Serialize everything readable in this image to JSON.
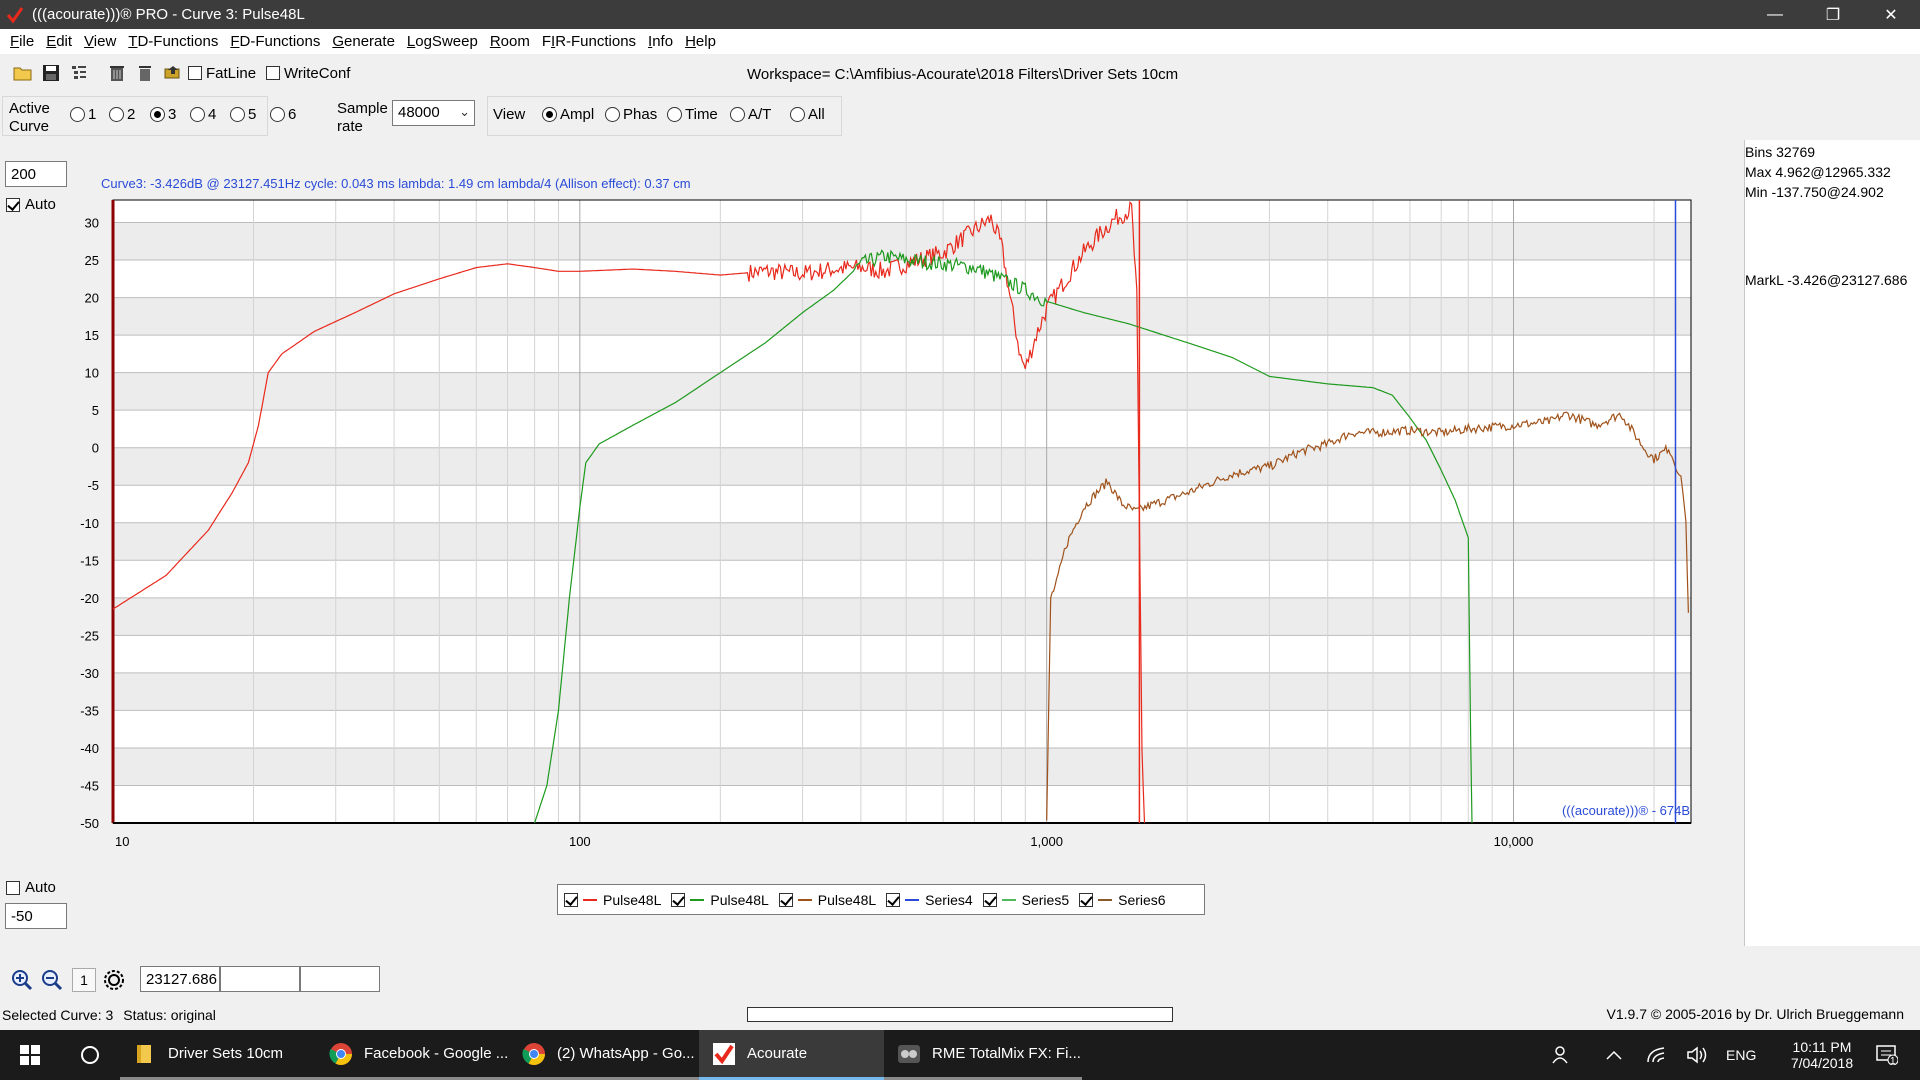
{
  "window": {
    "title": "(((acourate)))® PRO - Curve 3: Pulse48L",
    "controls": [
      "minimize",
      "restore",
      "close"
    ]
  },
  "menu": [
    {
      "pre": "",
      "ul": "F",
      "post": "ile"
    },
    {
      "pre": "",
      "ul": "E",
      "post": "dit"
    },
    {
      "pre": "",
      "ul": "V",
      "post": "iew"
    },
    {
      "pre": "",
      "ul": "T",
      "post": "D-Functions"
    },
    {
      "pre": "",
      "ul": "F",
      "post": "D-Functions"
    },
    {
      "pre": "",
      "ul": "G",
      "post": "enerate"
    },
    {
      "pre": "",
      "ul": "L",
      "post": "ogSweep"
    },
    {
      "pre": "",
      "ul": "R",
      "post": "oom"
    },
    {
      "pre": "F",
      "ul": "I",
      "post": "R-Functions"
    },
    {
      "pre": "",
      "ul": "I",
      "post": "nfo"
    },
    {
      "pre": "",
      "ul": "H",
      "post": "elp"
    }
  ],
  "toolbar": {
    "icons": [
      "open-folder-icon",
      "save-disk-icon",
      "tree-list-icon",
      "delete-stack-icon",
      "trash-icon",
      "import-icon"
    ],
    "fatline_label": "FatLine",
    "fatline_checked": false,
    "writeconf_label": "WriteConf",
    "writeconf_checked": false,
    "workspace": "Workspace= C:\\Amfibius-Acourate\\2018 Filters\\Driver Sets 10cm"
  },
  "curve_row": {
    "active_curve_label_1": "Active",
    "active_curve_label_2": "Curve",
    "curves": [
      "1",
      "2",
      "3",
      "4",
      "5",
      "6"
    ],
    "selected_curve": "3",
    "sample_rate_label_1": "Sample",
    "sample_rate_label_2": "rate",
    "sample_rate_value": "48000",
    "view_label": "View",
    "view_options": [
      "Ampl",
      "Phas",
      "Time",
      "A/T",
      "All"
    ],
    "selected_view": "Ampl"
  },
  "plot_controls": {
    "ymax_value": "200",
    "top_auto_label": "Auto",
    "top_auto_checked": true,
    "bottom_auto_label": "Auto",
    "bottom_auto_checked": false,
    "ymin_value": "-50"
  },
  "cursor_info": "Curve3:  -3.426dB @ 23127.451Hz   cycle: 0.043 ms   lambda: 1.49 cm   lambda/4 (Allison effect): 0.37 cm",
  "watermark": "(((acourate)))® - 674B",
  "side_panel": {
    "bins": "Bins 32769",
    "max": "Max 4.962@12965.332",
    "min": "Min -137.750@24.902",
    "markl": "MarkL -3.426@23127.686"
  },
  "legend": [
    {
      "label": "Pulse48L",
      "color": "#e8291c",
      "checked": true
    },
    {
      "label": "Pulse48L",
      "color": "#1e9a1e",
      "checked": true
    },
    {
      "label": "Pulse48L",
      "color": "#a0521a",
      "checked": true
    },
    {
      "label": "Series4",
      "color": "#2a4bd7",
      "checked": true
    },
    {
      "label": "Series5",
      "color": "#4fb85a",
      "checked": true
    },
    {
      "label": "Series6",
      "color": "#8a5a2e",
      "checked": true
    }
  ],
  "bottom_toolbar": {
    "icons": [
      "zoom-in-icon",
      "zoom-out-icon",
      "one-to-one-icon",
      "settings-gear-icon"
    ],
    "one_label": "1",
    "cursor_value": "23127.686",
    "field2": "",
    "field3": ""
  },
  "status": {
    "selected_curve": "Selected Curve: 3",
    "status": "Status: original",
    "version": "V1.9.7 © 2005-2016 by Dr. Ulrich Brueggemann"
  },
  "chart_data": {
    "type": "line",
    "x_scale": "log",
    "xlim": [
      10,
      24000
    ],
    "ylim": [
      -50,
      33
    ],
    "grid": true,
    "yticks": [
      30,
      25,
      20,
      15,
      10,
      5,
      0,
      -5,
      -10,
      -15,
      -20,
      -25,
      -30,
      -35,
      -40,
      -45,
      -50
    ],
    "xtick_labels": [
      {
        "x": 10,
        "label": "10"
      },
      {
        "x": 100,
        "label": "100"
      },
      {
        "x": 1000,
        "label": "1,000"
      },
      {
        "x": 10000,
        "label": "10,000"
      }
    ],
    "cursor_x": 1580,
    "marker_x": 23127,
    "series": [
      {
        "name": "Pulse48L",
        "color": "#e8291c",
        "noise": 1.2,
        "noise_from": 230,
        "points": [
          [
            10,
            -21.5
          ],
          [
            13,
            -17
          ],
          [
            16,
            -11
          ],
          [
            18,
            -6
          ],
          [
            19.5,
            -2
          ],
          [
            20.5,
            3
          ],
          [
            21.5,
            10
          ],
          [
            23,
            12.5
          ],
          [
            27,
            15.5
          ],
          [
            33,
            18
          ],
          [
            40,
            20.5
          ],
          [
            50,
            22.5
          ],
          [
            60,
            24
          ],
          [
            70,
            24.5
          ],
          [
            80,
            24
          ],
          [
            90,
            23.5
          ],
          [
            100,
            23.5
          ],
          [
            130,
            23.8
          ],
          [
            160,
            23.5
          ],
          [
            200,
            23
          ],
          [
            250,
            23.5
          ],
          [
            300,
            23.2
          ],
          [
            350,
            23.8
          ],
          [
            400,
            24
          ],
          [
            450,
            23.5
          ],
          [
            500,
            24.5
          ],
          [
            600,
            26
          ],
          [
            700,
            29
          ],
          [
            760,
            30.5
          ],
          [
            800,
            27
          ],
          [
            840,
            19
          ],
          [
            880,
            12
          ],
          [
            900,
            10.5
          ],
          [
            950,
            15
          ],
          [
            1000,
            18.5
          ],
          [
            1100,
            22.5
          ],
          [
            1200,
            26
          ],
          [
            1300,
            28.5
          ],
          [
            1400,
            30.5
          ],
          [
            1520,
            31.8
          ],
          [
            1560,
            20
          ],
          [
            1580,
            -10
          ],
          [
            1600,
            -40
          ],
          [
            1620,
            -50
          ]
        ]
      },
      {
        "name": "Pulse48L",
        "color": "#1e9a1e",
        "noise": 1.0,
        "noise_from": 380,
        "noise_to": 1000,
        "points": [
          [
            80,
            -50
          ],
          [
            85,
            -45
          ],
          [
            90,
            -35
          ],
          [
            95,
            -20
          ],
          [
            100,
            -8
          ],
          [
            103,
            -2
          ],
          [
            110,
            0.5
          ],
          [
            130,
            3
          ],
          [
            160,
            6
          ],
          [
            200,
            10
          ],
          [
            250,
            14
          ],
          [
            300,
            18
          ],
          [
            350,
            21
          ],
          [
            400,
            24.5
          ],
          [
            450,
            25.5
          ],
          [
            500,
            25
          ],
          [
            600,
            24.5
          ],
          [
            700,
            24
          ],
          [
            800,
            22.5
          ],
          [
            900,
            21
          ],
          [
            1000,
            19.5
          ],
          [
            1200,
            18
          ],
          [
            1500,
            16.5
          ],
          [
            2000,
            14
          ],
          [
            2500,
            12
          ],
          [
            3000,
            9.5
          ],
          [
            4000,
            8.5
          ],
          [
            5000,
            8
          ],
          [
            5500,
            7
          ],
          [
            6000,
            4
          ],
          [
            6500,
            1
          ],
          [
            7000,
            -3
          ],
          [
            7500,
            -7
          ],
          [
            8000,
            -12
          ],
          [
            8100,
            -40
          ],
          [
            8150,
            -50
          ]
        ]
      },
      {
        "name": "Pulse48L",
        "color": "#a0521a",
        "noise": 0.6,
        "noise_from": 1000,
        "points": [
          [
            1000,
            -50
          ],
          [
            1010,
            -35
          ],
          [
            1020,
            -20
          ],
          [
            1050,
            -18
          ],
          [
            1100,
            -13
          ],
          [
            1200,
            -8
          ],
          [
            1280,
            -6
          ],
          [
            1350,
            -4.5
          ],
          [
            1450,
            -7.5
          ],
          [
            1550,
            -8.5
          ],
          [
            1700,
            -7.5
          ],
          [
            2000,
            -6
          ],
          [
            2500,
            -3.5
          ],
          [
            3000,
            -2.5
          ],
          [
            3500,
            -0.5
          ],
          [
            4000,
            0.5
          ],
          [
            4500,
            2
          ],
          [
            5000,
            2
          ],
          [
            6000,
            2.3
          ],
          [
            7000,
            2
          ],
          [
            8000,
            2.5
          ],
          [
            10000,
            3
          ],
          [
            12000,
            3.5
          ],
          [
            13000,
            4.5
          ],
          [
            15000,
            3
          ],
          [
            17000,
            4.5
          ],
          [
            19000,
            0
          ],
          [
            20000,
            -1.5
          ],
          [
            21500,
            0
          ],
          [
            22500,
            -3
          ],
          [
            23000,
            -5
          ],
          [
            23400,
            -10
          ],
          [
            23700,
            -22
          ]
        ]
      }
    ]
  },
  "taskbar": {
    "apps": [
      {
        "label": "Driver Sets 10cm",
        "icon": "folder-icon",
        "state": "open"
      },
      {
        "label": "Facebook - Google ...",
        "icon": "chrome-icon",
        "state": "open"
      },
      {
        "label": "(2) WhatsApp - Go...",
        "icon": "chrome-icon",
        "state": "open"
      },
      {
        "label": "Acourate",
        "icon": "acourate-icon",
        "state": "active"
      },
      {
        "label": "RME TotalMix FX: Fi...",
        "icon": "totalmix-icon",
        "state": "open"
      }
    ],
    "lang": "ENG",
    "time": "10:11 PM",
    "date": "7/04/2018",
    "notification_count": "1"
  }
}
